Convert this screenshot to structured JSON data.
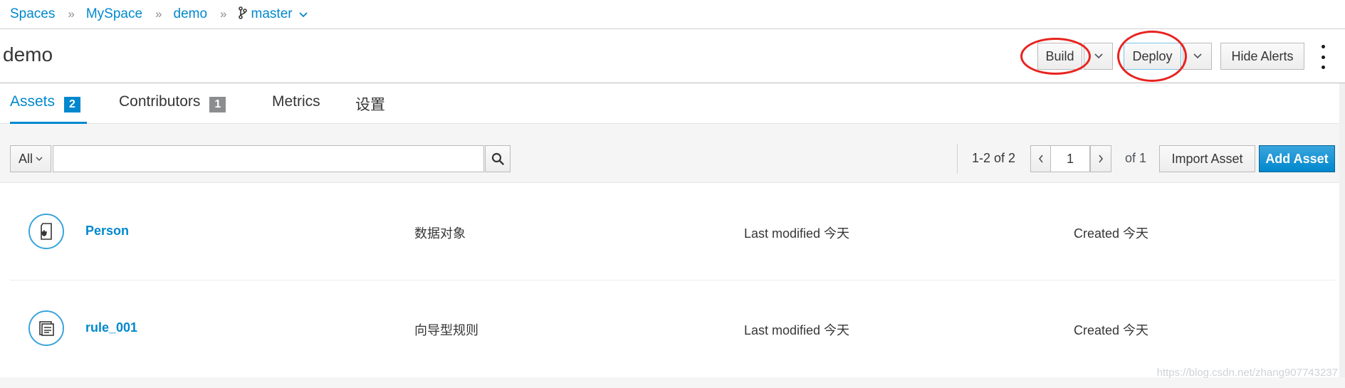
{
  "breadcrumb": {
    "items": [
      "Spaces",
      "MySpace",
      "demo"
    ],
    "branch": "master",
    "separator": "»"
  },
  "header": {
    "title": "demo",
    "build_label": "Build",
    "deploy_label": "Deploy",
    "hide_alerts_label": "Hide Alerts"
  },
  "tabs": [
    {
      "label": "Assets",
      "count": "2"
    },
    {
      "label": "Contributors",
      "count": "1"
    },
    {
      "label": "Metrics"
    },
    {
      "label": "设置"
    }
  ],
  "toolbar": {
    "filter": "All",
    "search_value": "",
    "range": "1-2 of 2",
    "page": "1",
    "of_pages": "of 1",
    "import_label": "Import Asset",
    "add_label": "Add Asset"
  },
  "assets": [
    {
      "name": "Person",
      "type": "数据对象",
      "modified": "Last modified 今天",
      "created": "Created 今天",
      "icon": "data-object-icon"
    },
    {
      "name": "rule_001",
      "type": "向导型规则",
      "modified": "Last modified 今天",
      "created": "Created 今天",
      "icon": "guided-rule-icon"
    }
  ],
  "annotation_color": "#e8231f",
  "accent_color": "#0088ce",
  "watermark": "https://blog.csdn.net/zhang907743237"
}
